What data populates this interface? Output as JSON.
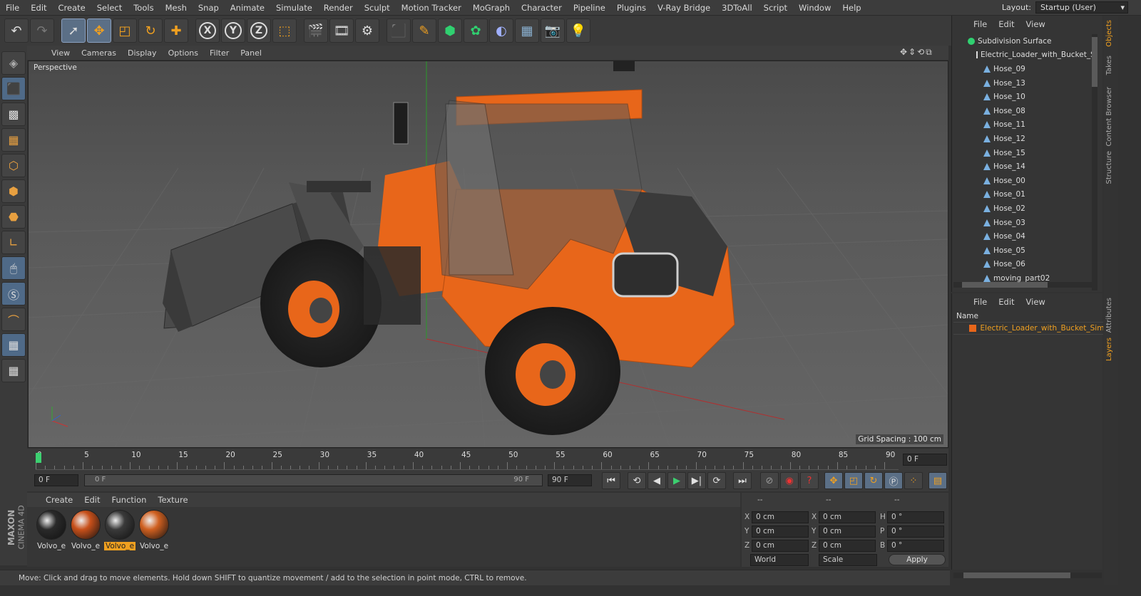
{
  "menu": [
    "File",
    "Edit",
    "Create",
    "Select",
    "Tools",
    "Mesh",
    "Snap",
    "Animate",
    "Simulate",
    "Render",
    "Sculpt",
    "Motion Tracker",
    "MoGraph",
    "Character",
    "Pipeline",
    "Plugins",
    "V-Ray Bridge",
    "3DToAll",
    "Script",
    "Window",
    "Help"
  ],
  "layout": {
    "label": "Layout:",
    "value": "Startup (User)"
  },
  "toolbar_icons": [
    "undo-icon",
    "redo-icon",
    "select-cursor-icon",
    "move-icon",
    "scale-icon",
    "rotate-icon",
    "move-plus-icon",
    "x-axis-icon",
    "y-axis-icon",
    "z-axis-icon",
    "coord-system-icon",
    "render-view-icon",
    "render-picture-viewer-icon",
    "render-settings-icon",
    "cube-primitive-icon",
    "pen-spline-icon",
    "subdivision-icon",
    "array-icon",
    "deformer-icon",
    "floor-icon",
    "camera-icon",
    "light-icon"
  ],
  "toolbar_glyphs": {
    "x": "X",
    "y": "Y",
    "z": "Z"
  },
  "viewport": {
    "menu": [
      "View",
      "Cameras",
      "Display",
      "Options",
      "Filter",
      "Panel"
    ],
    "label": "Perspective",
    "grid_spacing": "Grid Spacing : 100 cm"
  },
  "timeline": {
    "ticks": [
      "0",
      "5",
      "10",
      "15",
      "20",
      "25",
      "30",
      "35",
      "40",
      "45",
      "50",
      "55",
      "60",
      "65",
      "70",
      "75",
      "80",
      "85",
      "90"
    ],
    "end_field": "0 F"
  },
  "playbar": {
    "start": "0 F",
    "slider_left": "0 F",
    "slider_right": "90 F",
    "end": "90 F"
  },
  "materials": {
    "menu": [
      "Create",
      "Edit",
      "Function",
      "Texture"
    ],
    "items": [
      {
        "label": "Volvo_e",
        "selected": false,
        "color": "#2a2a2a"
      },
      {
        "label": "Volvo_e",
        "selected": false,
        "color": "#c8501a"
      },
      {
        "label": "Volvo_e",
        "selected": true,
        "color": "#3a3a3a"
      },
      {
        "label": "Volvo_e",
        "selected": false,
        "color": "#d06020"
      }
    ]
  },
  "coords": {
    "header_left": "--",
    "header_mid": "--",
    "header_right": "--",
    "rows": [
      {
        "a": "X",
        "av": "0 cm",
        "b": "X",
        "bv": "0 cm",
        "c": "H",
        "cv": "0 °"
      },
      {
        "a": "Y",
        "av": "0 cm",
        "b": "Y",
        "bv": "0 cm",
        "c": "P",
        "cv": "0 °"
      },
      {
        "a": "Z",
        "av": "0 cm",
        "b": "Z",
        "bv": "0 cm",
        "c": "B",
        "cv": "0 °"
      }
    ],
    "world": "World",
    "scale": "Scale",
    "apply": "Apply"
  },
  "status": "Move: Click and drag to move elements. Hold down SHIFT to quantize movement / add to the selection in point mode, CTRL to remove.",
  "objects": {
    "menu": [
      "File",
      "Edit",
      "View"
    ],
    "root": "Subdivision Surface",
    "child": "Electric_Loader_with_Bucket_S",
    "items": [
      "Hose_09",
      "Hose_13",
      "Hose_10",
      "Hose_08",
      "Hose_11",
      "Hose_12",
      "Hose_15",
      "Hose_14",
      "Hose_00",
      "Hose_01",
      "Hose_02",
      "Hose_03",
      "Hose_04",
      "Hose_05",
      "Hose_06",
      "moving_part02"
    ]
  },
  "layers": {
    "menu": [
      "File",
      "Edit",
      "View"
    ],
    "col": "Name",
    "item": "Electric_Loader_with_Bucket_Simp"
  },
  "right_tabs": [
    {
      "label": "Objects",
      "on": true
    },
    {
      "label": "Takes",
      "on": false
    },
    {
      "label": "Content Browser",
      "on": false
    },
    {
      "label": "Structure",
      "on": false
    },
    {
      "label": "Attributes",
      "on": false
    },
    {
      "label": "Layers",
      "on": true
    }
  ],
  "logo": {
    "brand": "MAXON",
    "product": "CINEMA 4D"
  },
  "colors": {
    "accent": "#f0a020",
    "loader_orange": "#e8661a",
    "viewport_bg": "#5e5e5e"
  }
}
